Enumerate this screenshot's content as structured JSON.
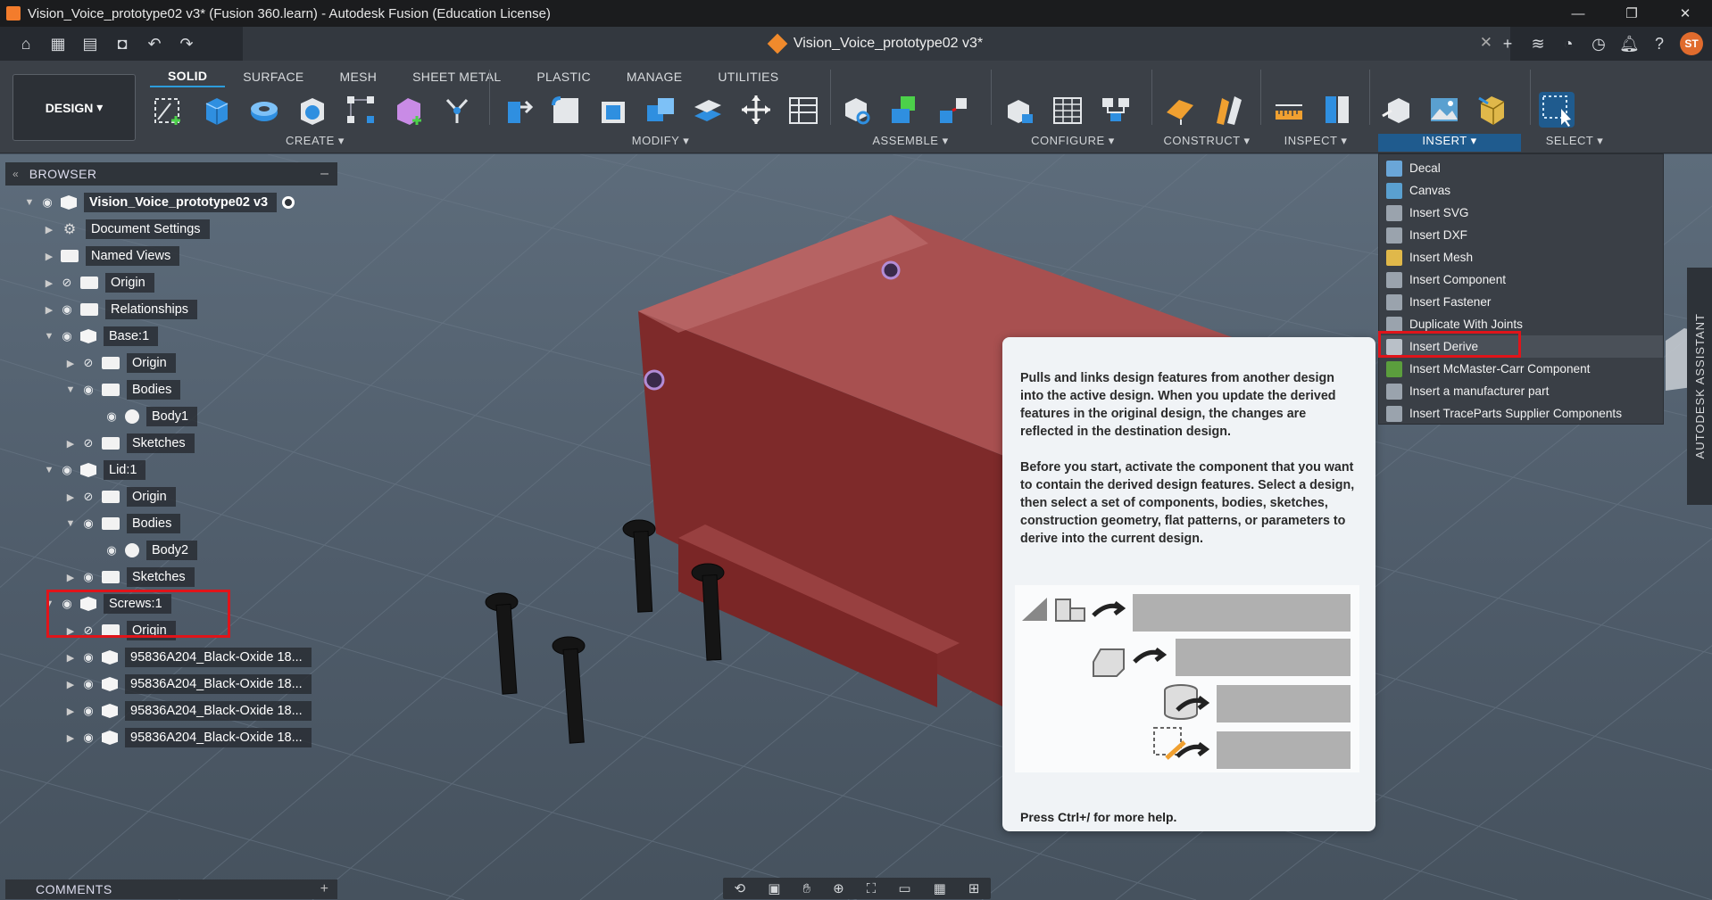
{
  "window": {
    "title": "Vision_Voice_prototype02 v3* (Fusion 360.learn) - Autodesk Fusion (Education License)",
    "controls": [
      "—",
      "❐",
      "✕"
    ]
  },
  "quick_access": {
    "icons": [
      "home-icon",
      "grid-icon",
      "file-icon",
      "save-icon",
      "undo-icon",
      "redo-icon"
    ],
    "doc_tab": "Vision_Voice_prototype02 v3*",
    "right_icons": [
      "plus-icon",
      "job-status-icon",
      "extensions-icon",
      "clock-icon",
      "bell-icon",
      "help-icon"
    ],
    "user_initials": "ST"
  },
  "toolbar": {
    "workspace": "DESIGN",
    "tabs": [
      "SOLID",
      "SURFACE",
      "MESH",
      "SHEET METAL",
      "PLASTIC",
      "MANAGE",
      "UTILITIES"
    ],
    "active_tab": "SOLID",
    "groups": [
      {
        "label": "CREATE"
      },
      {
        "label": "MODIFY"
      },
      {
        "label": "ASSEMBLE"
      },
      {
        "label": "CONFIGURE"
      },
      {
        "label": "CONSTRUCT"
      },
      {
        "label": "INSPECT"
      },
      {
        "label": "INSERT"
      },
      {
        "label": "SELECT"
      }
    ]
  },
  "browser": {
    "title": "BROWSER",
    "nodes": [
      {
        "label": "Vision_Voice_prototype02 v3"
      },
      {
        "label": "Document Settings"
      },
      {
        "label": "Named Views"
      },
      {
        "label": "Origin"
      },
      {
        "label": "Relationships"
      },
      {
        "label": "Base:1"
      },
      {
        "label": "Origin"
      },
      {
        "label": "Bodies"
      },
      {
        "label": "Body1"
      },
      {
        "label": "Sketches"
      },
      {
        "label": "Lid:1"
      },
      {
        "label": "Origin"
      },
      {
        "label": "Bodies"
      },
      {
        "label": "Body2"
      },
      {
        "label": "Sketches"
      },
      {
        "label": "Screws:1"
      },
      {
        "label": "Origin"
      },
      {
        "label": "95836A204_Black-Oxide 18..."
      },
      {
        "label": "95836A204_Black-Oxide 18..."
      },
      {
        "label": "95836A204_Black-Oxide 18..."
      },
      {
        "label": "95836A204_Black-Oxide 18..."
      }
    ]
  },
  "comments": {
    "title": "COMMENTS"
  },
  "insert_menu": {
    "items": [
      {
        "label": "Decal",
        "color": "#6aa6d8"
      },
      {
        "label": "Canvas",
        "color": "#5aa0d0"
      },
      {
        "label": "Insert SVG",
        "color": "#9aa3ad"
      },
      {
        "label": "Insert DXF",
        "color": "#9aa3ad"
      },
      {
        "label": "Insert Mesh",
        "color": "#e0b84a"
      },
      {
        "label": "Insert Component",
        "color": "#9aa3ad"
      },
      {
        "label": "Insert Fastener",
        "color": "#9aa3ad"
      },
      {
        "label": "Duplicate With Joints",
        "color": "#9aa3ad"
      },
      {
        "label": "Insert Derive",
        "color": "#b9c0c8"
      },
      {
        "label": "Insert McMaster-Carr Component",
        "color": "#5b9e3d"
      },
      {
        "label": "Insert a manufacturer part",
        "color": "#9aa3ad"
      },
      {
        "label": "Insert TraceParts Supplier Components",
        "color": "#9aa3ad"
      }
    ],
    "hovered": "Insert Derive"
  },
  "tooltip": {
    "paragraph1": "Pulls and links design features from another design into the active design. When you update the derived features in the original design, the changes are reflected in the destination design.",
    "paragraph2": "Before you start, activate the component that you want to contain the derived design features. Select a design, then select a set of components, bodies, sketches, construction geometry, flat patterns, or parameters to derive into the current design.",
    "footer": "Press Ctrl+/ for more help."
  },
  "assistant": {
    "label": "AUTODESK ASSISTANT"
  },
  "colors": {
    "accent": "#1f5b8e",
    "highlight": "#e0141a",
    "model": "#8a2e2e"
  }
}
